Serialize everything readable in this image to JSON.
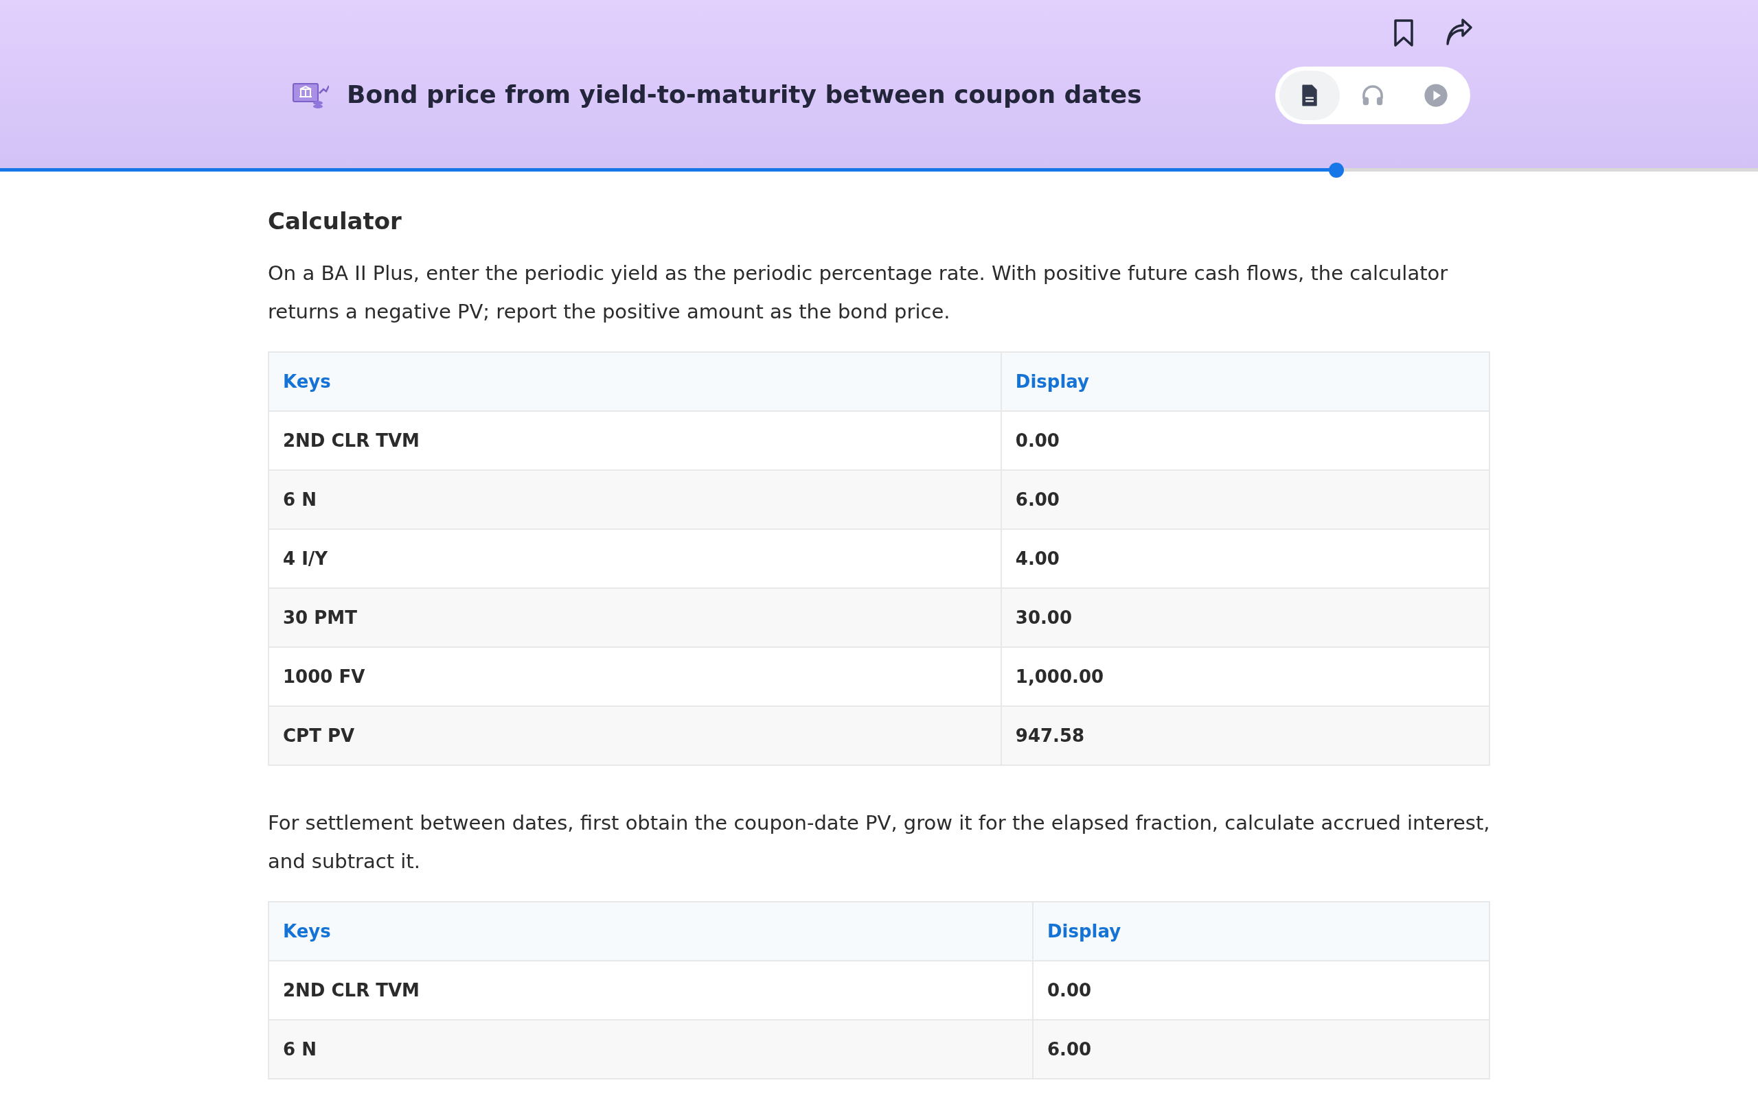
{
  "header": {
    "title": "Bond price from yield-to-maturity between coupon dates",
    "view_modes": [
      {
        "kind": "document",
        "selected": true
      },
      {
        "kind": "audio",
        "selected": false
      },
      {
        "kind": "video",
        "selected": false
      }
    ]
  },
  "progress": {
    "level": 0.76
  },
  "sections": [
    {
      "kind": "heading",
      "text": "Calculator"
    },
    {
      "kind": "paragraph",
      "text": "On a BA II Plus, enter the periodic yield as the periodic percentage rate. With positive future cash flows, the calculator returns a negative PV; report the positive amount as the bond price."
    },
    {
      "kind": "table",
      "columns": [
        "Keys",
        "Display"
      ],
      "rows": [
        [
          "2ND CLR TVM",
          "0.00"
        ],
        [
          "6 N",
          "6.00"
        ],
        [
          "4 I/Y",
          "4.00"
        ],
        [
          "30 PMT",
          "30.00"
        ],
        [
          "1000 FV",
          "1,000.00"
        ],
        [
          "CPT PV",
          "947.58"
        ]
      ]
    },
    {
      "kind": "paragraph",
      "text": "For settlement between dates, first obtain the coupon-date PV, grow it for the elapsed fraction, calculate accrued interest, and subtract it."
    },
    {
      "kind": "table",
      "columns": [
        "Keys",
        "Display"
      ],
      "rows": [
        [
          "2ND CLR TVM",
          "0.00"
        ],
        [
          "6 N",
          "6.00"
        ]
      ]
    }
  ]
}
